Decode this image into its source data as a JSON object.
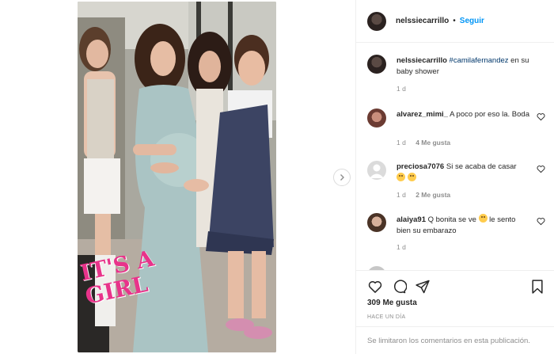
{
  "post": {
    "username": "nelssiecarrillo",
    "follow_label": "Seguir",
    "separator": "•",
    "photo_overlay_text": "IT'S A GIRL"
  },
  "caption": {
    "username": "nelssiecarrillo",
    "tag": "#camilafernandez",
    "text": " en su baby shower",
    "time": "1 d"
  },
  "comments": [
    {
      "username": "alvarez_mimi_",
      "text": "A poco por eso la. Boda",
      "time": "1 d",
      "likes": "4 Me gusta"
    },
    {
      "username": "preciosa7076",
      "text": "Si se acaba de casar",
      "emoji": "🤔🤔",
      "time": "1 d",
      "likes": "2 Me gusta"
    },
    {
      "username": "alaiya91",
      "text": "Q bonita se ve",
      "text2": "le sento bien su embarazo",
      "emoji": "🤩",
      "time": "1 d"
    }
  ],
  "actions": {
    "likes": "309 Me gusta",
    "posted_ago": "HACE UN DÍA",
    "comments_closed": "Se limitaron los comentarios en esta publicación."
  },
  "icons": {
    "next": "chevron-right-icon",
    "like": "heart-icon",
    "comment": "comment-icon",
    "share": "paper-plane-icon",
    "save": "bookmark-icon"
  },
  "colors": {
    "link_blue": "#0095f6",
    "muted": "#8e8e8e",
    "text": "#262626",
    "border": "#efefef",
    "overlay_pink": "#e8338a"
  }
}
